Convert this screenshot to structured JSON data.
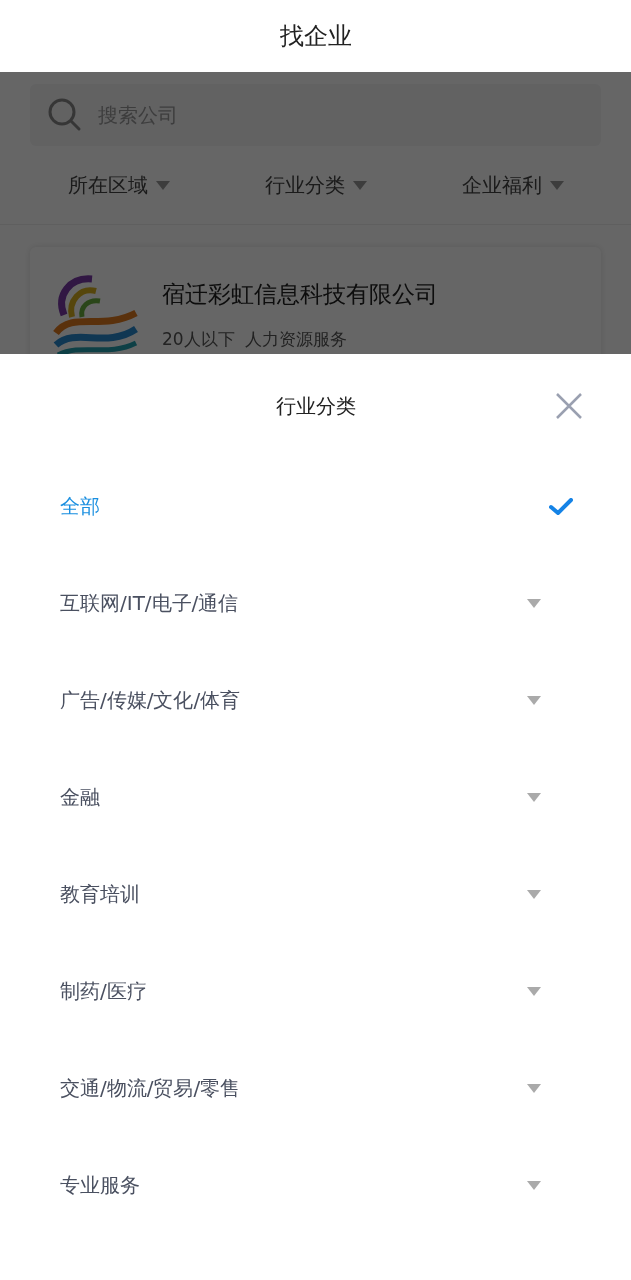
{
  "header": {
    "title": "找企业"
  },
  "search": {
    "placeholder": "搜索公司"
  },
  "filters": [
    {
      "label": "所在区域"
    },
    {
      "label": "行业分类"
    },
    {
      "label": "企业福利"
    }
  ],
  "companies": [
    {
      "name": "宿迁彩虹信息科技有限公司",
      "size": "20人以下",
      "industry": "人力资源服务"
    }
  ],
  "sheet": {
    "title": "行业分类",
    "items": [
      {
        "label": "全部",
        "selected": true
      },
      {
        "label": "互联网/IT/电子/通信",
        "selected": false
      },
      {
        "label": "广告/传媒/文化/体育",
        "selected": false
      },
      {
        "label": "金融",
        "selected": false
      },
      {
        "label": "教育培训",
        "selected": false
      },
      {
        "label": "制药/医疗",
        "selected": false
      },
      {
        "label": "交通/物流/贸易/零售",
        "selected": false
      },
      {
        "label": "专业服务",
        "selected": false
      }
    ]
  }
}
